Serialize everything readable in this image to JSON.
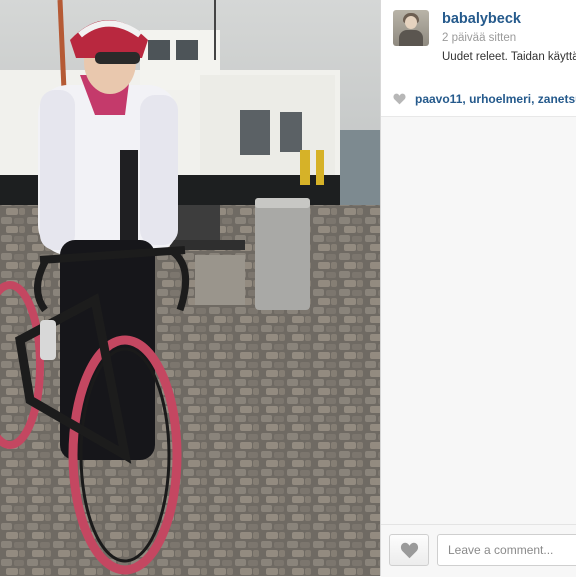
{
  "post": {
    "photo_alt": "Cyclist with road bike on a cobblestone harbour pier next to a white ferry",
    "image_icon": "photo-content"
  },
  "author": {
    "username": "babalybeck",
    "time_ago": "2 päivää sitten",
    "caption": "Uudet releet. Taidan käyttää"
  },
  "likes": {
    "icon": "heart-icon",
    "users": [
      "paavo11",
      "urhoelmeri",
      "zanetsu"
    ],
    "separator": ","
  },
  "comment": {
    "placeholder": "Leave a comment...",
    "like_icon": "heart-icon"
  },
  "colors": {
    "username": "#255a8c",
    "panel_bg": "#f7f7f7"
  }
}
